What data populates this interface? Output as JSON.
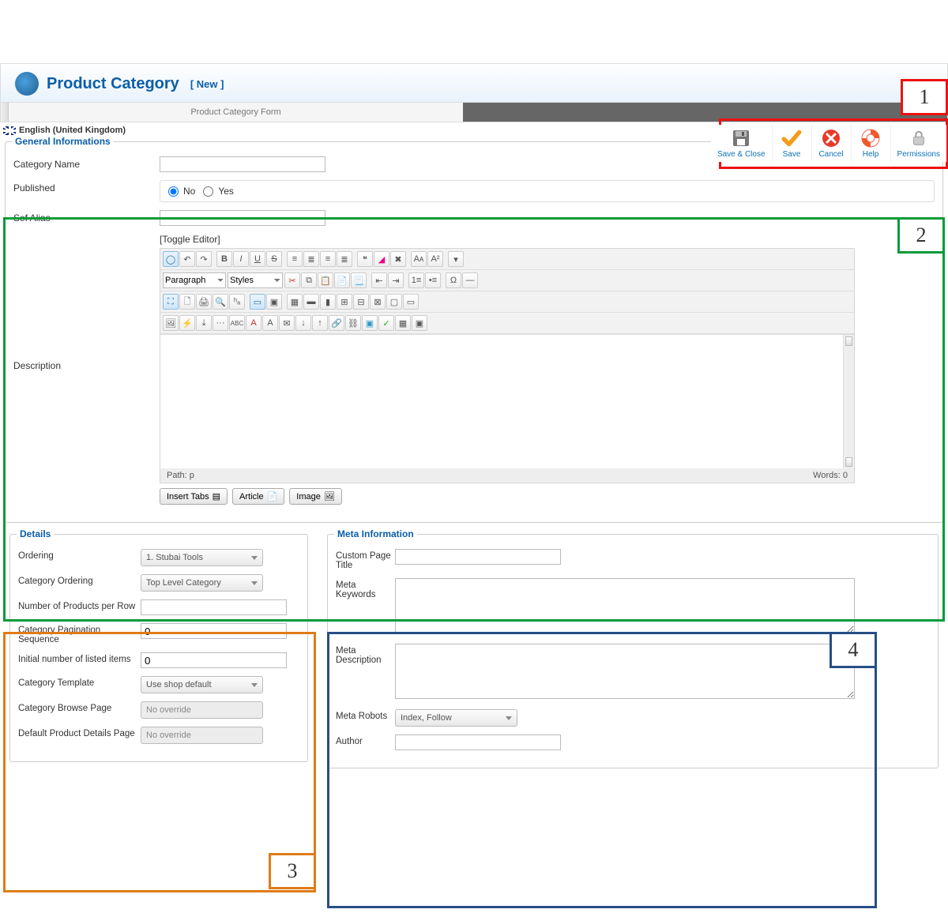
{
  "header": {
    "title": "Product Category",
    "new_badge": "[ New ]"
  },
  "toolbar": {
    "save_close": "Save & Close",
    "save": "Save",
    "cancel": "Cancel",
    "help": "Help",
    "permissions": "Permissions"
  },
  "tabs": {
    "form": "Product Category Form"
  },
  "language": "English (United Kingdom)",
  "general": {
    "legend": "General Informations",
    "category_name_label": "Category Name",
    "category_name_value": "",
    "published_label": "Published",
    "published_no": "No",
    "published_yes": "Yes",
    "sef_alias_label": "Sef Alias",
    "sef_alias_value": "",
    "description_label": "Description",
    "toggle_editor": "[Toggle Editor]",
    "editor": {
      "paragraph_sel": "Paragraph",
      "styles_sel": "Styles",
      "path_label": "Path:",
      "path_value": "p",
      "words_label": "Words:",
      "words_value": "0",
      "insert_tabs": "Insert Tabs",
      "article": "Article",
      "image": "Image"
    }
  },
  "details": {
    "legend": "Details",
    "ordering_label": "Ordering",
    "ordering_value": "1. Stubai Tools",
    "cat_ordering_label": "Category Ordering",
    "cat_ordering_value": "Top Level Category",
    "prod_per_row_label": "Number of Products per Row",
    "prod_per_row_value": "",
    "cat_pag_seq_label": "Category Pagination Sequence",
    "cat_pag_seq_value": "0",
    "init_listed_label": "Initial number of listed items",
    "init_listed_value": "0",
    "cat_template_label": "Category Template",
    "cat_template_value": "Use shop default",
    "cat_browse_label": "Category Browse Page",
    "cat_browse_value": "No override",
    "def_prod_details_label": "Default Product Details Page",
    "def_prod_details_value": "No override"
  },
  "meta": {
    "legend": "Meta Information",
    "title_label": "Custom Page Title",
    "title_value": "",
    "keywords_label": "Meta Keywords",
    "keywords_value": "",
    "desc_label": "Meta Description",
    "desc_value": "",
    "robots_label": "Meta Robots",
    "robots_value": "Index, Follow",
    "author_label": "Author",
    "author_value": ""
  },
  "annotations": {
    "n1": "1",
    "n2": "2",
    "n3": "3",
    "n4": "4"
  }
}
